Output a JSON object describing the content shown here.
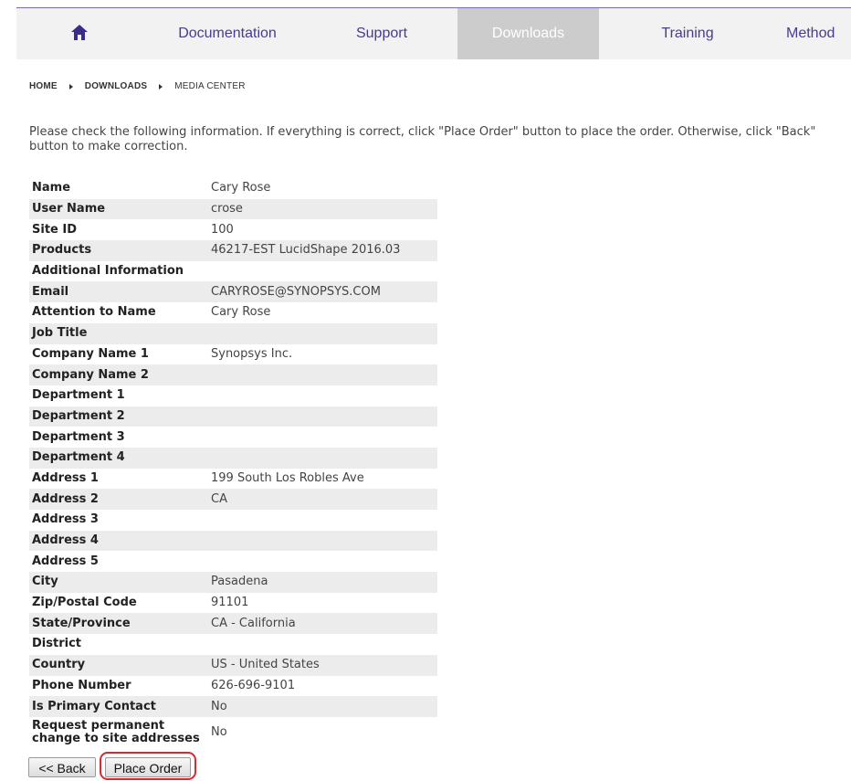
{
  "nav": {
    "items": [
      {
        "label": "Documentation"
      },
      {
        "label": "Support"
      },
      {
        "label": "Downloads",
        "active": true
      },
      {
        "label": "Training"
      },
      {
        "label": "Method"
      }
    ],
    "home_icon": "house-icon",
    "accent": "#4b3a8f"
  },
  "breadcrumb": {
    "home": "HOME",
    "downloads": "DOWNLOADS",
    "current": "MEDIA CENTER"
  },
  "instructions": "Please check the following information. If everything is correct, click \"Place Order\" button to place the order. Otherwise, click \"Back\" button to make correction.",
  "fields": [
    {
      "label": "Name",
      "value": "Cary Rose"
    },
    {
      "label": "User Name",
      "value": "crose"
    },
    {
      "label": "Site ID",
      "value": "100"
    },
    {
      "label": "Products",
      "value": "46217-EST LucidShape 2016.03"
    },
    {
      "label": "Additional Information",
      "value": ""
    },
    {
      "label": "Email",
      "value": "CARYROSE@SYNOPSYS.COM"
    },
    {
      "label": "Attention to Name",
      "value": "Cary Rose"
    },
    {
      "label": "Job Title",
      "value": ""
    },
    {
      "label": "Company Name 1",
      "value": "Synopsys Inc."
    },
    {
      "label": "Company Name 2",
      "value": ""
    },
    {
      "label": "Department 1",
      "value": ""
    },
    {
      "label": "Department 2",
      "value": ""
    },
    {
      "label": "Department 3",
      "value": ""
    },
    {
      "label": "Department 4",
      "value": ""
    },
    {
      "label": "Address 1",
      "value": "199 South Los Robles Ave"
    },
    {
      "label": "Address 2",
      "value": "CA"
    },
    {
      "label": "Address 3",
      "value": ""
    },
    {
      "label": "Address 4",
      "value": ""
    },
    {
      "label": "Address 5",
      "value": ""
    },
    {
      "label": "City",
      "value": "Pasadena"
    },
    {
      "label": "Zip/Postal Code",
      "value": "91101"
    },
    {
      "label": "State/Province",
      "value": "CA - California"
    },
    {
      "label": "District",
      "value": ""
    },
    {
      "label": "Country",
      "value": "US - United States"
    },
    {
      "label": "Phone Number",
      "value": "626-696-9101"
    },
    {
      "label": "Is Primary Contact",
      "value": "No"
    },
    {
      "label": "Request permanent change to site addresses",
      "value": "No"
    }
  ],
  "buttons": {
    "back": "<< Back",
    "place_order": "Place Order"
  },
  "colors": {
    "highlight": "#d9282f",
    "active_tab_bg": "#cccccc"
  }
}
